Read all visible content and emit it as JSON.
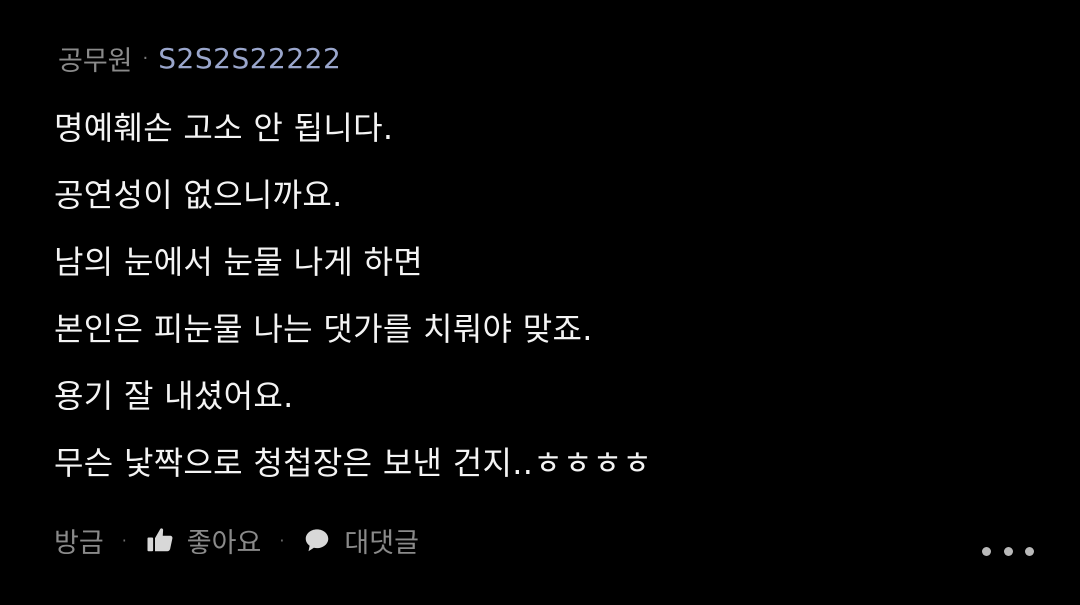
{
  "comment": {
    "author_type": "공무원",
    "separator": "·",
    "nickname": "S2S2S22222",
    "lines": [
      "명예훼손 고소 안 됩니다.",
      "공연성이 없으니까요.",
      "남의 눈에서 눈물 나게 하면",
      "본인은 피눈물 나는 댓가를 치뤄야 맞죠.",
      "용기 잘 내셨어요.",
      "무슨 낯짝으로 청첩장은 보낸 건지..ㅎㅎㅎㅎ"
    ],
    "footer": {
      "time": "방금",
      "like_label": "좋아요",
      "reply_label": "대댓글",
      "separator": "·"
    },
    "more_icon": "more-dots-icon",
    "like_icon": "thumbs-up-icon",
    "reply_icon": "speech-bubble-icon"
  },
  "colors": {
    "background": "#000000",
    "text": "#f4f4f4",
    "muted": "#8a8a8a",
    "nickname": "#9aa6cc"
  }
}
